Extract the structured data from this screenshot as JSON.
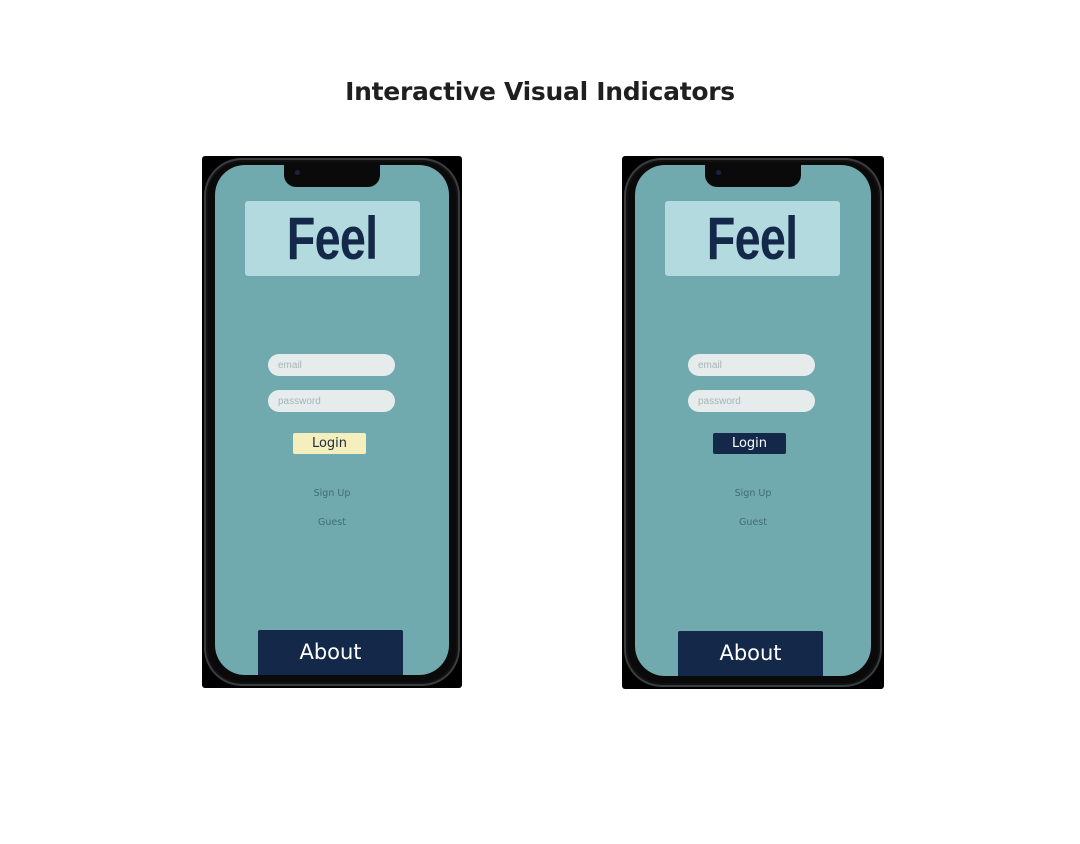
{
  "page": {
    "title": "Interactive Visual Indicators"
  },
  "phones": [
    {
      "logo": "Feel",
      "email_placeholder": "email",
      "password_placeholder": "password",
      "login_label": "Login",
      "login_color": "#f5efbd",
      "signup_label": "Sign Up",
      "guest_label": "Guest",
      "about_label": "About"
    },
    {
      "logo": "Feel",
      "email_placeholder": "email",
      "password_placeholder": "password",
      "login_label": "Login",
      "login_color": "#14294a",
      "signup_label": "Sign Up",
      "guest_label": "Guest",
      "about_label": "About"
    }
  ],
  "colors": {
    "screen_bg": "#70a9ae",
    "logo_bg": "#b3dadf",
    "brand_navy": "#14294a",
    "login_default": "#f5efbd",
    "login_active": "#14294a"
  }
}
